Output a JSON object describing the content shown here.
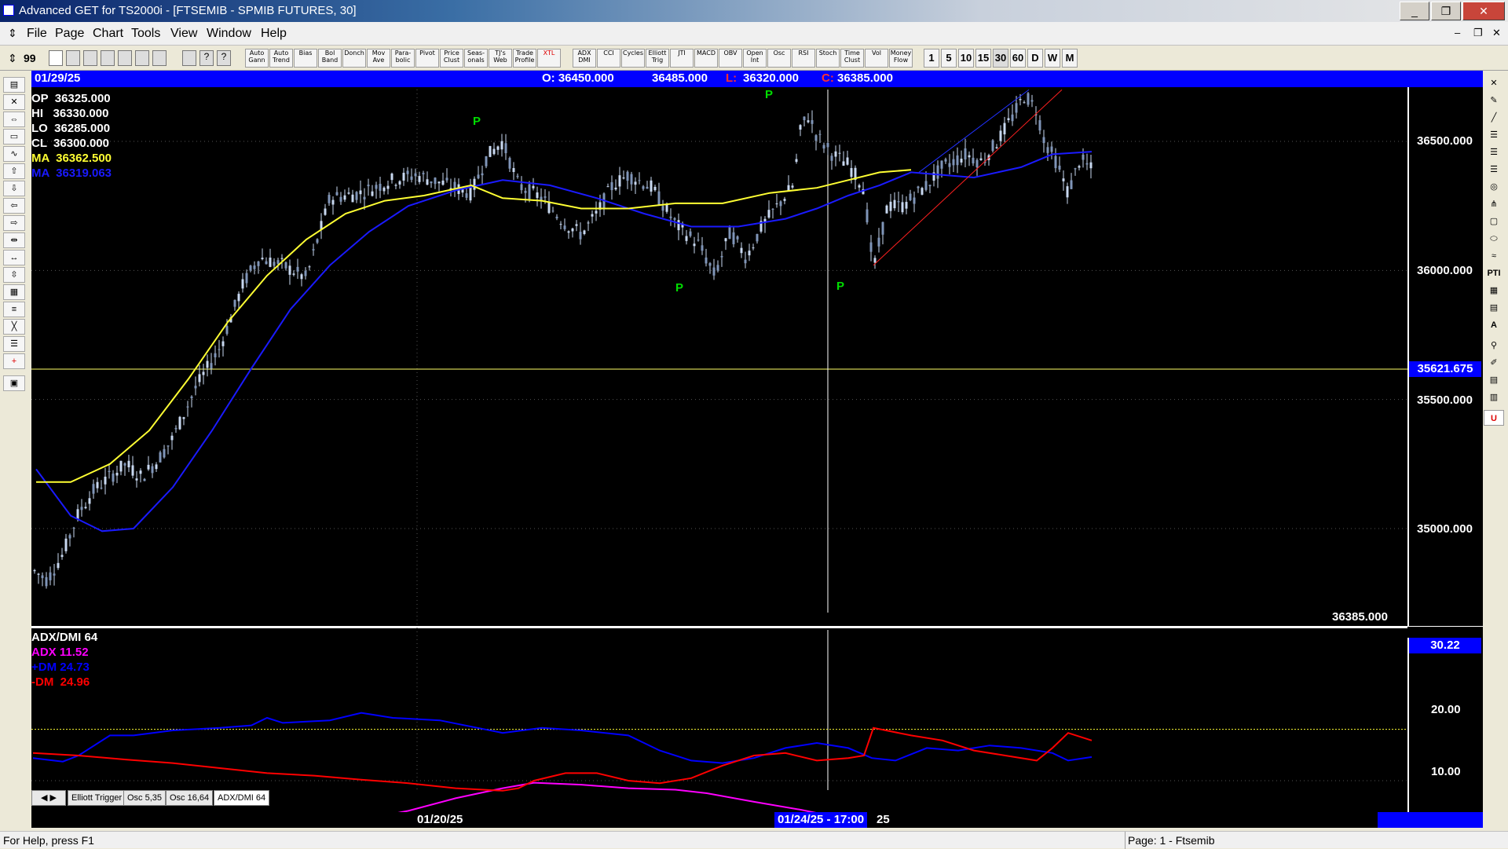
{
  "window": {
    "title": "Advanced GET for TS2000i - [FTSEMIB - SPMIB FUTURES, 30]",
    "controls": [
      "_",
      "❐",
      "✕"
    ]
  },
  "menu": [
    "File",
    "Page",
    "Chart",
    "Tools",
    "View",
    "Window",
    "Help"
  ],
  "toolbar": {
    "buttons": [
      "Auto Gann",
      "Auto Trend",
      "Bias",
      "Bol Band",
      "Donch",
      "Mov Ave",
      "Para-bolic",
      "Pivot",
      "Price Clust",
      "Seas-onals",
      "TJ's Web",
      "Trade Profile",
      "XTL",
      "ADX DMI",
      "CCI",
      "Cycles",
      "Elliott Trig",
      "JTI",
      "MACD",
      "OBV",
      "Open Int",
      "Osc",
      "RSI",
      "Stoch",
      "Time Clust",
      "Vol",
      "Money Flow"
    ],
    "intervals": [
      "1",
      "5",
      "10",
      "15",
      "30",
      "60",
      "D",
      "W",
      "M"
    ]
  },
  "header": {
    "date": "01/29/25",
    "open": "O: 36450.000",
    "high": "36485.000",
    "low_label": "L:",
    "low": "36320.000",
    "close_label": "C:",
    "close": "36385.000"
  },
  "legend": {
    "op": "OP  36325.000",
    "hi": "HI   36330.000",
    "lo": "LO  36285.000",
    "cl": "CL  36300.000",
    "ma1": "MA  36362.500",
    "ma2": "MA  36319.063"
  },
  "price_axis": {
    "labels": [
      "36500.000",
      "36000.000",
      "35500.000",
      "35000.000"
    ],
    "crosshair_value": "35621.675",
    "last_price": "36385.000"
  },
  "indicator": {
    "title": "ADX/DMI 64",
    "adx": "ADX 11.52",
    "pdm": "+DM 24.73",
    "mdm": "-DM  24.96",
    "level": "30.22",
    "axis": [
      "20.00",
      "10.00"
    ]
  },
  "tabs": [
    "Elliott Trigger",
    "Osc 5,35",
    "Osc 16,64",
    "ADX/DMI 64"
  ],
  "time_axis": {
    "label1": "01/20/25",
    "crosshair": "01/24/25 - 17:00",
    "suffix": "25"
  },
  "pivot_marker": "P",
  "status": {
    "help": "For Help, press F1",
    "page": "Page: 1 - Ftsemib"
  },
  "colors": {
    "ma_fast": "#ffff33",
    "ma_slow": "#1a1aff",
    "adx": "#ff00ff",
    "plus_dm": "#0000ff",
    "minus_dm": "#ff0000",
    "pivot": "#00dd00",
    "candles": "#c8d8f0"
  }
}
